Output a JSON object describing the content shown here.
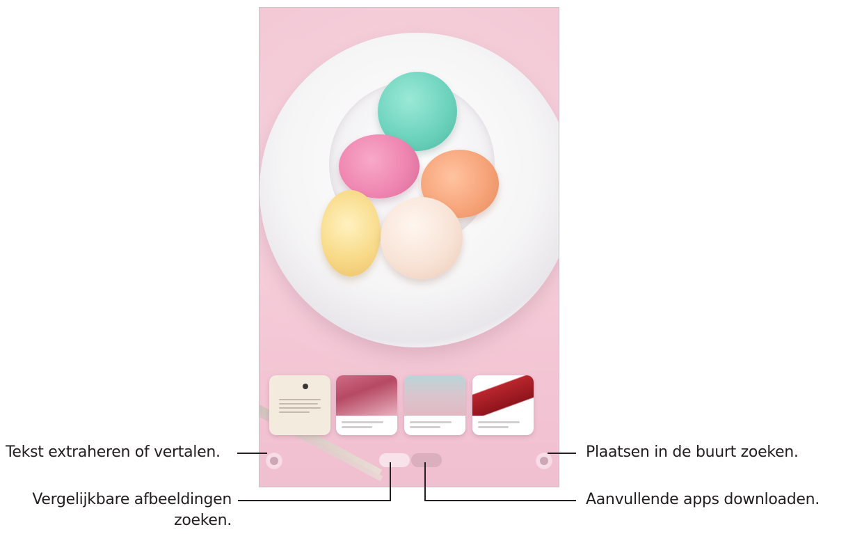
{
  "annotations": {
    "text_extract": "Tekst extraheren of vertalen.",
    "similar_images": {
      "line1": "Vergelijkbare afbeeldingen",
      "line2": "zoeken."
    },
    "nearby_places": "Plaatsen in de buurt zoeken.",
    "download_apps": "Aanvullende apps downloaden."
  },
  "colors": {
    "background": "#ffffff",
    "screen_background": "#f4cbd8",
    "callout_line": "#231f20"
  },
  "icons": {
    "text_button": "text-extract-icon",
    "place_button": "location-icon"
  }
}
